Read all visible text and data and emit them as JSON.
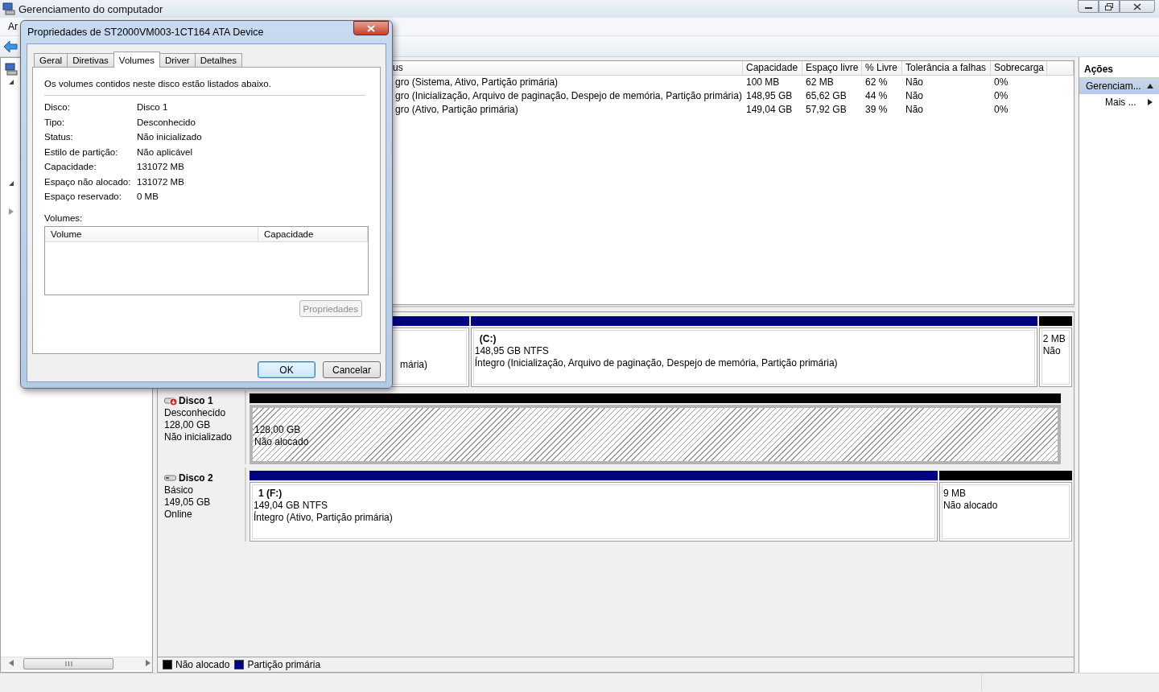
{
  "window": {
    "title": "Gerenciamento do computador"
  },
  "menu_bar": [
    "Ar"
  ],
  "tree": [
    {
      "expanded": true
    },
    {
      "expanded": true
    },
    {
      "expanded": false
    }
  ],
  "volume_table": {
    "columns": [
      "us",
      "Capacidade",
      "Espaço livre",
      "% Livre",
      "Tolerância a falhas",
      "Sobrecarga"
    ],
    "rows": [
      [
        "gro (Sistema, Ativo, Partição primária)",
        "100 MB",
        "62 MB",
        "62 %",
        "Não",
        "0%"
      ],
      [
        "gro (Inicialização, Arquivo de paginação, Despejo de memória, Partição primária)",
        "148,95 GB",
        "65,62 GB",
        "44 %",
        "Não",
        "0%"
      ],
      [
        "gro (Ativo, Partição primária)",
        "149,04 GB",
        "57,92 GB",
        "39 %",
        "Não",
        "0%"
      ]
    ]
  },
  "disks": [
    {
      "partitions": [
        {
          "kind": "primary",
          "status": "mária)"
        },
        {
          "kind": "primary",
          "name": "(C:)",
          "size": "148,95 GB NTFS",
          "status": "Íntegro (Inicialização, Arquivo de paginação, Despejo de memória, Partição primária)"
        },
        {
          "kind": "unallocated",
          "size": "2 MB",
          "status": "Não"
        }
      ]
    },
    {
      "name": "Disco 1",
      "warning": true,
      "type": "Desconhecido",
      "capacity": "128,00 GB",
      "state": "Não inicializado",
      "partitions": [
        {
          "kind": "uninitialized",
          "size": "128,00 GB",
          "status": "Não alocado"
        }
      ]
    },
    {
      "name": "Disco 2",
      "warning": false,
      "type": "Básico",
      "capacity": "149,05 GB",
      "state": "Online",
      "partitions": [
        {
          "kind": "primary",
          "name": "1  (F:)",
          "size": "149,04 GB NTFS",
          "status": "Íntegro (Ativo, Partição primária)"
        },
        {
          "kind": "unallocated",
          "size": "9 MB",
          "status": "Não alocado"
        }
      ]
    }
  ],
  "legend": [
    {
      "label": "Não alocado",
      "color": "#000000"
    },
    {
      "label": "Partição primária",
      "color": "#000080"
    }
  ],
  "actions": {
    "title": "Ações",
    "items": [
      {
        "kind": "section",
        "label": "Gerenciam...",
        "expanded": true
      },
      {
        "kind": "submenu",
        "label": "Mais ..."
      }
    ]
  },
  "dialog": {
    "title": "Propriedades de ST2000VM003-1CT164 ATA Device",
    "tabs": [
      {
        "label": "Geral",
        "selected": false
      },
      {
        "label": "Diretivas",
        "selected": false
      },
      {
        "label": "Volumes",
        "selected": true
      },
      {
        "label": "Driver",
        "selected": false
      },
      {
        "label": "Detalhes",
        "selected": false
      }
    ],
    "intro": "Os volumes contidos neste disco estão listados abaixo.",
    "properties": [
      {
        "label": "Disco:",
        "value": "Disco 1"
      },
      {
        "label": "Tipo:",
        "value": "Desconhecido"
      },
      {
        "label": "Status:",
        "value": "Não inicializado"
      },
      {
        "label": "Estilo de partição:",
        "value": "Não aplicável"
      },
      {
        "label": "Capacidade:",
        "value": "131072 MB"
      },
      {
        "label": "Espaço não alocado:",
        "value": "131072 MB"
      },
      {
        "label": "Espaço reservado:",
        "value": "0 MB"
      }
    ],
    "volumes_label": "Volumes:",
    "volume_columns": [
      "Volume",
      "Capacidade"
    ],
    "properties_button": {
      "label": "Propriedades",
      "disabled": true
    },
    "buttons": [
      {
        "label": "OK",
        "default": true
      },
      {
        "label": "Cancelar",
        "default": false
      }
    ]
  }
}
